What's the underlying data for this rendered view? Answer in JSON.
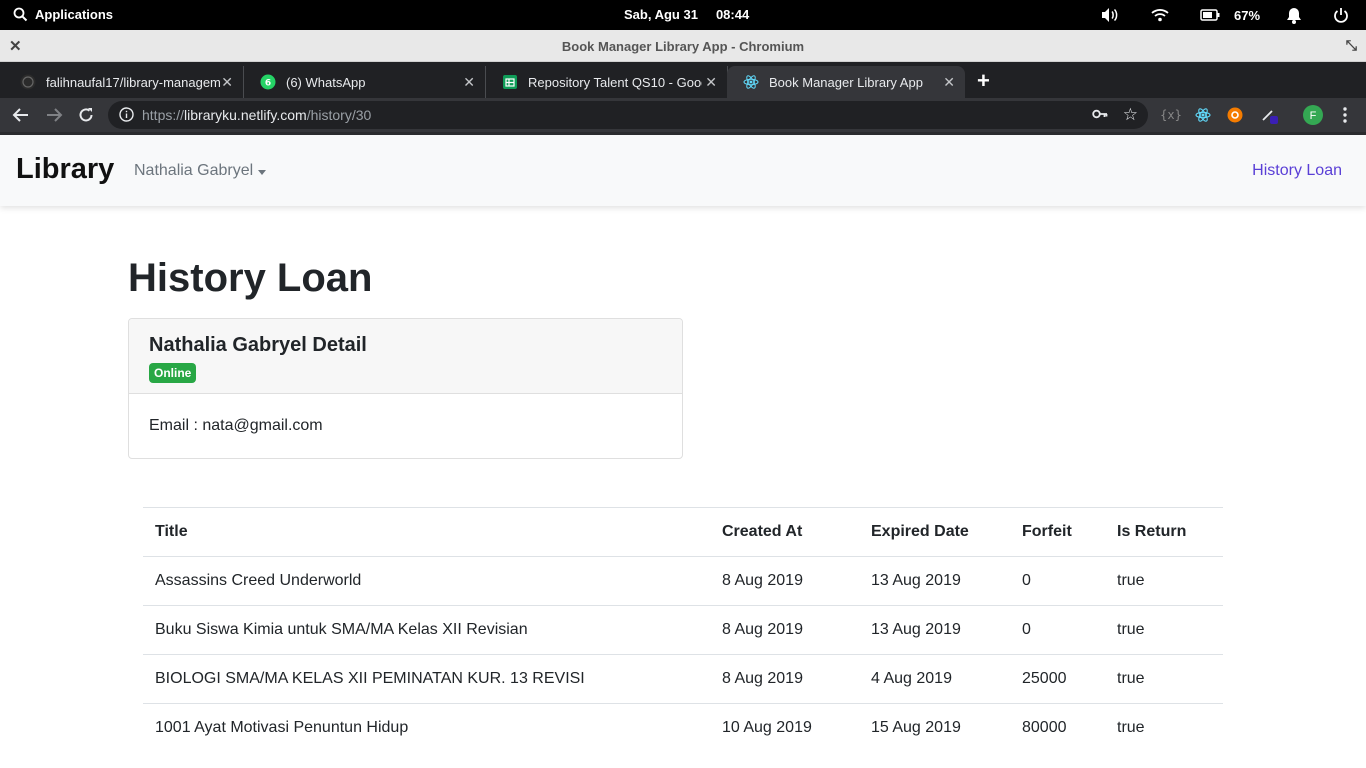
{
  "os_bar": {
    "apps_label": "Applications",
    "date": "Sab, Agu 31",
    "time": "08:44",
    "battery_percent": "67%"
  },
  "window": {
    "title": "Book Manager Library App - Chromium"
  },
  "tabs": [
    {
      "label": "falihnaufal17/library-managem",
      "icon": "github-icon"
    },
    {
      "label": "(6) WhatsApp",
      "icon": "whatsapp-icon",
      "badge": "6"
    },
    {
      "label": "Repository Talent QS10 - Googl",
      "icon": "sheets-icon"
    },
    {
      "label": "Book Manager Library App",
      "icon": "react-icon",
      "active": true
    }
  ],
  "omnibox": {
    "url_scheme": "https://",
    "url_host": "libraryku.netlify.com",
    "url_path": "/history/30"
  },
  "profile": {
    "initial": "F",
    "color": "#34a853"
  },
  "navbar": {
    "brand": "Library",
    "user_name": "Nathalia Gabryel",
    "history_link": "History Loan"
  },
  "page": {
    "title": "History Loan",
    "card": {
      "title": "Nathalia Gabryel Detail",
      "status": "Online",
      "email": "Email : nata@gmail.com"
    },
    "table": {
      "headers": [
        "Title",
        "Created At",
        "Expired Date",
        "Forfeit",
        "Is Return"
      ],
      "rows": [
        [
          "Assassins Creed Underworld",
          "8 Aug 2019",
          "13 Aug 2019",
          "0",
          "true"
        ],
        [
          "Buku Siswa Kimia untuk SMA/MA Kelas XII Revisian",
          "8 Aug 2019",
          "13 Aug 2019",
          "0",
          "true"
        ],
        [
          "BIOLOGI SMA/MA KELAS XII PEMINATAN KUR. 13 REVISI",
          "8 Aug 2019",
          "4 Aug 2019",
          "25000",
          "true"
        ],
        [
          "1001 Ayat Motivasi Penuntun Hidup",
          "10 Aug 2019",
          "15 Aug 2019",
          "80000",
          "true"
        ]
      ]
    }
  },
  "colors": {
    "accent_link": "#5a3fd6",
    "badge_success": "#28a745"
  }
}
